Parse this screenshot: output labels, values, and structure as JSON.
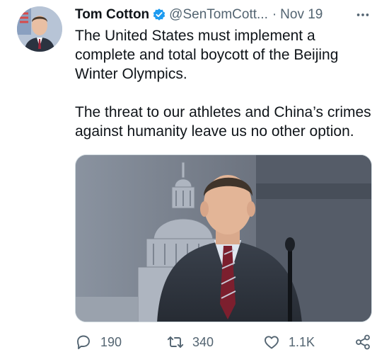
{
  "author": {
    "name": "Tom Cotton",
    "handle": "@SenTomCott...",
    "separator": "·",
    "date": "Nov 19"
  },
  "tweet": {
    "paragraphs": [
      "The United States must implement a complete and total boycott of the Beijing Winter Olympics.",
      "The threat to our athletes and China’s crimes against humanity leave us no other option."
    ]
  },
  "actions": {
    "replies": "190",
    "retweets": "340",
    "likes": "1.1K"
  },
  "colors": {
    "text": "#0f1419",
    "secondary": "#536471",
    "verified": "#1d9bf0"
  },
  "icons": [
    "verified-badge-icon",
    "more-icon",
    "reply-icon",
    "retweet-icon",
    "like-icon",
    "share-icon"
  ]
}
